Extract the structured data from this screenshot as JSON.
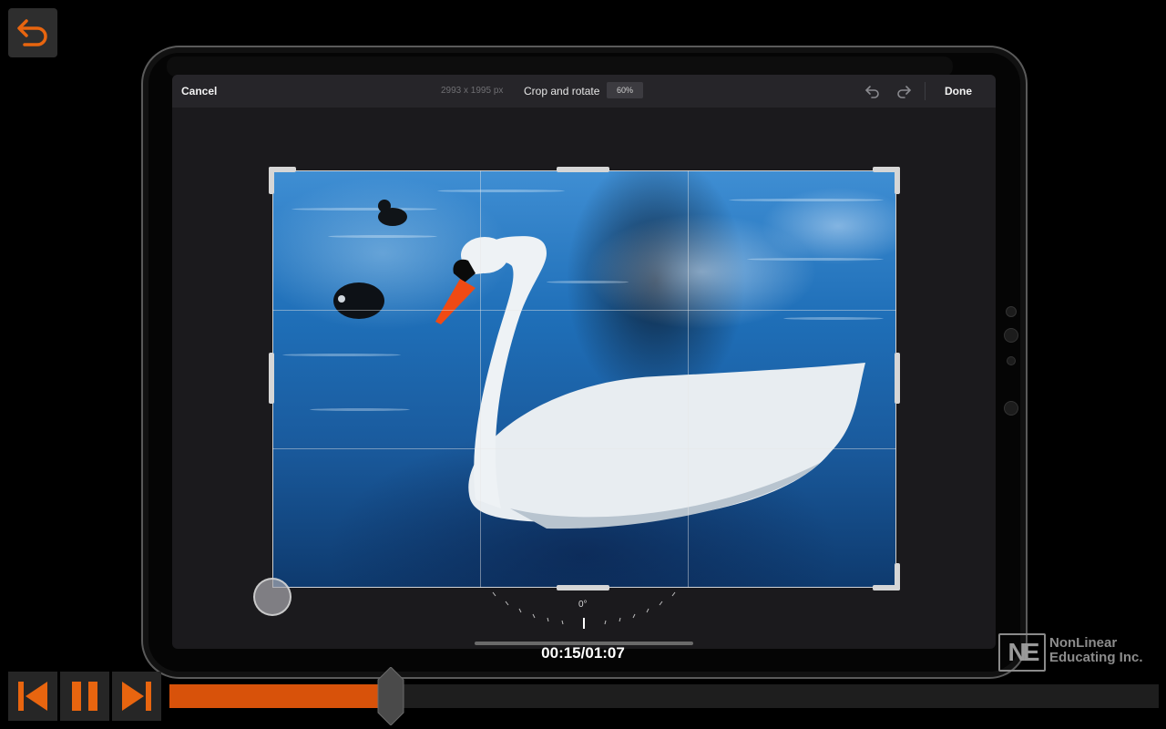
{
  "window": {
    "brand_color": "#d8520a"
  },
  "editor": {
    "cancel_label": "Cancel",
    "image_dimensions": "2993 x 1995 px",
    "title": "Crop and rotate",
    "zoom_level": "60%",
    "done_label": "Done",
    "rotation_readout": "0°"
  },
  "player": {
    "time_display": "00:15/01:07",
    "progress_fraction": 0.224
  },
  "icons": {
    "back": "back-arrow-icon",
    "undo": "undo-icon",
    "redo": "redo-icon",
    "previous": "skip-previous-icon",
    "pause": "pause-icon",
    "next": "skip-next-icon"
  },
  "watermark": {
    "logo_letters": "NE",
    "line1": "NonLinear",
    "line2": "Educating Inc."
  }
}
